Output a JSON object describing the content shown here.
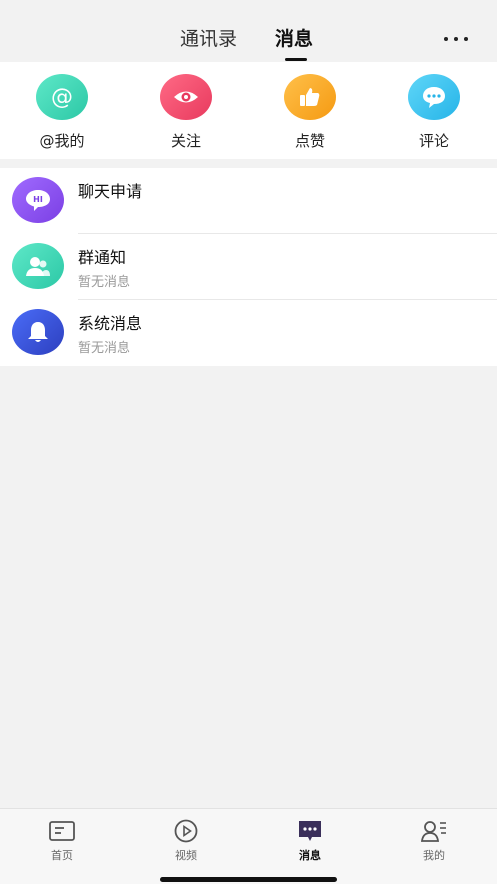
{
  "header": {
    "tabs": [
      {
        "label": "通讯录"
      },
      {
        "label": "消息"
      }
    ],
    "active_tab": "消息",
    "more_icon": "more-dots-icon"
  },
  "quick_actions": [
    {
      "label": "@我的",
      "icon": "at-icon",
      "color": "#3fd6b8"
    },
    {
      "label": "关注",
      "icon": "eye-icon",
      "color": "#f04a6b"
    },
    {
      "label": "点赞",
      "icon": "thumbs-up-icon",
      "color": "#f5a623"
    },
    {
      "label": "评论",
      "icon": "comment-icon",
      "color": "#3ec6f0"
    }
  ],
  "messages": [
    {
      "title": "聊天申请",
      "subtitle": "",
      "icon": "hi-chat-icon",
      "color": "#8b5cf6"
    },
    {
      "title": "群通知",
      "subtitle": "暂无消息",
      "icon": "group-icon",
      "color": "#3fd6b8"
    },
    {
      "title": "系统消息",
      "subtitle": "暂无消息",
      "icon": "bell-icon",
      "color": "#3b5bdb"
    }
  ],
  "tabbar": [
    {
      "label": "首页",
      "icon": "home-icon"
    },
    {
      "label": "视频",
      "icon": "play-icon"
    },
    {
      "label": "消息",
      "icon": "message-icon",
      "active": true
    },
    {
      "label": "我的",
      "icon": "profile-icon"
    }
  ]
}
